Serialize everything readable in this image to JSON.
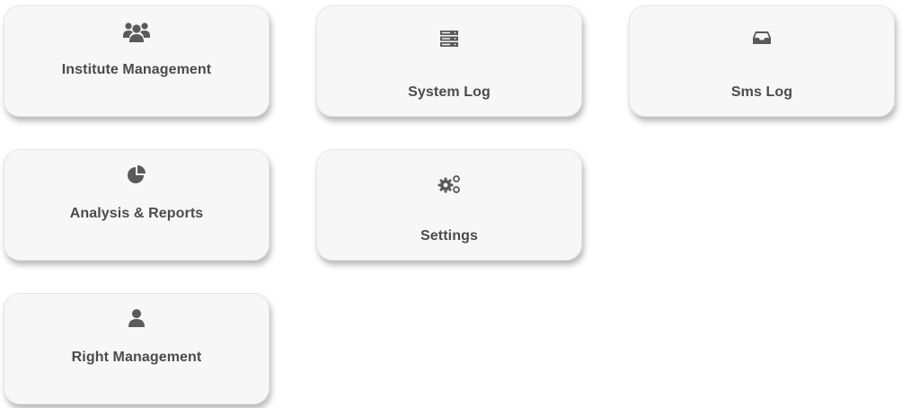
{
  "tiles": [
    {
      "label": "Institute Management",
      "icon": "users-icon"
    },
    {
      "label": "System Log",
      "icon": "server-list-icon"
    },
    {
      "label": "Sms Log",
      "icon": "inbox-icon"
    },
    {
      "label": "Analysis & Reports",
      "icon": "pie-chart-icon"
    },
    {
      "label": "Settings",
      "icon": "cogs-icon"
    },
    {
      "label": "Right Management",
      "icon": "user-icon"
    }
  ]
}
